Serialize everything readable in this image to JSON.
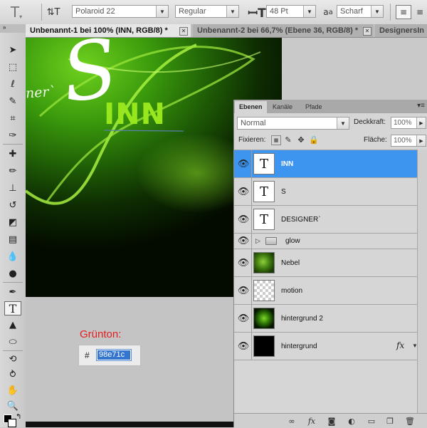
{
  "options_bar": {
    "tool_icon": "text-tool-icon",
    "orientation_icon": "text-orientation-icon",
    "font_family": "Polaroid 22",
    "font_style": "Regular",
    "font_size": "48 Pt",
    "aa_label": "a",
    "aa_sub": "a",
    "aa_mode": "Scharf",
    "align_icon": "align-left-icon"
  },
  "tabs": [
    {
      "label": "Unbenannt-1 bei 100% (INN, RGB/8) *",
      "active": true
    },
    {
      "label": "Unbenannt-2 bei 66,7% (Ebene 36, RGB/8) *",
      "active": false
    },
    {
      "label": "DesignersIn",
      "active": false
    }
  ],
  "canvas_text": {
    "designer": "ner`",
    "s": "S",
    "inn": "INN"
  },
  "color_note": {
    "label": "Grünton:",
    "hash": "#",
    "hex_value": "98e71c",
    "accent": "#98e71c"
  },
  "layers_panel": {
    "tabs": [
      "Ebenen",
      "Kanäle",
      "Pfade"
    ],
    "blend_mode": "Normal",
    "opacity_label": "Deckkraft:",
    "opacity_value": "100%",
    "lock_label": "Fixieren:",
    "fill_label": "Fläche:",
    "fill_value": "100%",
    "layers": [
      {
        "name": "INN",
        "type": "text",
        "thumb": "T",
        "selected": true
      },
      {
        "name": "S",
        "type": "text",
        "thumb": "T",
        "selected": false
      },
      {
        "name": "DESIGNER`",
        "type": "text",
        "thumb": "T",
        "selected": false
      },
      {
        "name": "glow",
        "type": "group",
        "thumb": "",
        "selected": false
      },
      {
        "name": "Nebel",
        "type": "image",
        "thumb": "",
        "selected": false
      },
      {
        "name": "motion",
        "type": "image",
        "thumb": "",
        "selected": false
      },
      {
        "name": "hintergrund 2",
        "type": "image",
        "thumb": "",
        "selected": false
      },
      {
        "name": "hintergrund",
        "type": "image",
        "thumb": "",
        "selected": false,
        "fx": "fx"
      }
    ]
  },
  "colors": {
    "selection_blue": "#3d95f0",
    "canvas_green": "#3a9a0c",
    "label_red": "#e02020"
  }
}
